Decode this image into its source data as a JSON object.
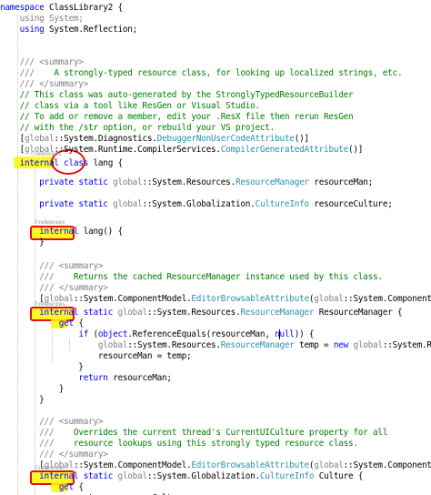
{
  "lens": {
    "ref_0": "0 references",
    "ref_1": "0 references",
    "ref_2": "0 references",
    "ref_3": "0 references"
  },
  "code": {
    "l1": [
      {
        "t": "namespace",
        "c": "k"
      },
      {
        "t": " ClassLibrary2 {",
        "c": "x"
      }
    ],
    "l2": [
      {
        "t": "    using System;",
        "c": "g"
      }
    ],
    "l3": [
      {
        "t": "    ",
        "c": "x"
      },
      {
        "t": "using",
        "c": "k"
      },
      {
        "t": " System.Reflection;",
        "c": "x"
      }
    ],
    "l4": [],
    "l5": [],
    "l6": [
      {
        "t": "    /// <summary>",
        "c": "g"
      }
    ],
    "l7": [
      {
        "t": "    ///",
        "c": "g"
      },
      {
        "t": "    A strongly-typed resource class, for looking up localized strings, etc.",
        "c": "c"
      }
    ],
    "l8": [
      {
        "t": "    /// </summary>",
        "c": "g"
      }
    ],
    "l9": [
      {
        "t": "    // This class was auto-generated by the StronglyTypedResourceBuilder",
        "c": "c"
      }
    ],
    "l10": [
      {
        "t": "    // class via a tool like ResGen or Visual Studio.",
        "c": "c"
      }
    ],
    "l11": [
      {
        "t": "    // To add or remove a member, edit your .ResX file then rerun ResGen",
        "c": "c"
      }
    ],
    "l12": [
      {
        "t": "    // with the /str option, or rebuild your VS project.",
        "c": "c"
      }
    ],
    "l13": [
      {
        "t": "    [",
        "c": "x"
      },
      {
        "t": "global",
        "c": "gl"
      },
      {
        "t": "::System.Diagnostics.",
        "c": "x"
      },
      {
        "t": "DebuggerNonUserCodeAttribute",
        "c": "t"
      },
      {
        "t": "()]",
        "c": "x"
      }
    ],
    "l14": [
      {
        "t": "    [",
        "c": "x"
      },
      {
        "t": "global",
        "c": "gl"
      },
      {
        "t": "::System.Runtime.CompilerServices.",
        "c": "x"
      },
      {
        "t": "CompilerGeneratedAttribute",
        "c": "t"
      },
      {
        "t": "()]",
        "c": "x"
      }
    ],
    "l15": [
      {
        "t": "    internal",
        "c": "k"
      },
      {
        "t": " ",
        "c": "x"
      },
      {
        "t": "class",
        "c": "k"
      },
      {
        "t": " lang {",
        "c": "x"
      }
    ],
    "l16": [],
    "l17": [
      {
        "t": "        ",
        "c": "x"
      },
      {
        "t": "private",
        "c": "k"
      },
      {
        "t": " ",
        "c": "x"
      },
      {
        "t": "static",
        "c": "k"
      },
      {
        "t": " ",
        "c": "x"
      },
      {
        "t": "global",
        "c": "gl"
      },
      {
        "t": "::System.Resources.",
        "c": "x"
      },
      {
        "t": "ResourceManager",
        "c": "t"
      },
      {
        "t": " resourceMan;",
        "c": "x"
      }
    ],
    "l18": [],
    "l19": [
      {
        "t": "        ",
        "c": "x"
      },
      {
        "t": "private",
        "c": "k"
      },
      {
        "t": " ",
        "c": "x"
      },
      {
        "t": "static",
        "c": "k"
      },
      {
        "t": " ",
        "c": "x"
      },
      {
        "t": "global",
        "c": "gl"
      },
      {
        "t": "::System.Globalization.",
        "c": "x"
      },
      {
        "t": "CultureInfo",
        "c": "t"
      },
      {
        "t": " resourceCulture;",
        "c": "x"
      }
    ],
    "l20": [],
    "l21": [
      {
        "t": "        ",
        "c": "x"
      },
      {
        "t": "internal",
        "c": "k"
      },
      {
        "t": " lang() {",
        "c": "x"
      }
    ],
    "l22": [
      {
        "t": "        }",
        "c": "x"
      }
    ],
    "l23": [],
    "l24": [
      {
        "t": "        /// <summary>",
        "c": "g"
      }
    ],
    "l25": [
      {
        "t": "        ///",
        "c": "g"
      },
      {
        "t": "    Returns the cached ResourceManager instance used by this class.",
        "c": "c"
      }
    ],
    "l26": [
      {
        "t": "        /// </summary>",
        "c": "g"
      }
    ],
    "l27": [
      {
        "t": "        [",
        "c": "x"
      },
      {
        "t": "global",
        "c": "gl"
      },
      {
        "t": "::System.ComponentModel.",
        "c": "x"
      },
      {
        "t": "EditorBrowsableAttribute",
        "c": "t"
      },
      {
        "t": "(",
        "c": "x"
      },
      {
        "t": "global",
        "c": "gl"
      },
      {
        "t": "::System.ComponentModel.",
        "c": "x"
      },
      {
        "t": "Edito",
        "c": "t"
      }
    ],
    "l28": [
      {
        "t": "        ",
        "c": "x"
      },
      {
        "t": "internal",
        "c": "k"
      },
      {
        "t": " ",
        "c": "x"
      },
      {
        "t": "static",
        "c": "k"
      },
      {
        "t": " ",
        "c": "x"
      },
      {
        "t": "global",
        "c": "gl"
      },
      {
        "t": "::System.Resources.",
        "c": "x"
      },
      {
        "t": "ResourceManager",
        "c": "t"
      },
      {
        "t": " ResourceManager {",
        "c": "x"
      }
    ],
    "l29": [
      {
        "t": "            ",
        "c": "x"
      },
      {
        "t": "get",
        "c": "k"
      },
      {
        "t": " {",
        "c": "x"
      }
    ],
    "l30": [
      {
        "t": "                ",
        "c": "x"
      },
      {
        "t": "if",
        "c": "k"
      },
      {
        "t": " (",
        "c": "x"
      },
      {
        "t": "object",
        "c": "k"
      },
      {
        "t": ".ReferenceEquals(resourceMan, ",
        "c": "x"
      },
      {
        "t": "null",
        "c": "k"
      },
      {
        "t": ")) {",
        "c": "x"
      }
    ],
    "l31": [
      {
        "t": "                    ",
        "c": "x"
      },
      {
        "t": "global",
        "c": "gl"
      },
      {
        "t": "::System.Resources.",
        "c": "x"
      },
      {
        "t": "ResourceManager",
        "c": "t"
      },
      {
        "t": " temp = ",
        "c": "x"
      },
      {
        "t": "new",
        "c": "k"
      },
      {
        "t": " ",
        "c": "x"
      },
      {
        "t": "global",
        "c": "gl"
      },
      {
        "t": "::System.Resources.",
        "c": "x"
      }
    ],
    "l32": [
      {
        "t": "                    resourceMan = temp;",
        "c": "x"
      }
    ],
    "l33": [
      {
        "t": "                }",
        "c": "x"
      }
    ],
    "l34": [
      {
        "t": "                ",
        "c": "x"
      },
      {
        "t": "return",
        "c": "k"
      },
      {
        "t": " resourceMan;",
        "c": "x"
      }
    ],
    "l35": [
      {
        "t": "            }",
        "c": "x"
      }
    ],
    "l36": [
      {
        "t": "        }",
        "c": "x"
      }
    ],
    "l37": [],
    "l38": [
      {
        "t": "        /// <summary>",
        "c": "g"
      }
    ],
    "l39": [
      {
        "t": "        ///",
        "c": "g"
      },
      {
        "t": "    Overrides the current thread's CurrentUICulture property for all",
        "c": "c"
      }
    ],
    "l40": [
      {
        "t": "        ///",
        "c": "g"
      },
      {
        "t": "    resource lookups using this strongly typed resource class.",
        "c": "c"
      }
    ],
    "l41": [
      {
        "t": "        /// </summary>",
        "c": "g"
      }
    ],
    "l42": [
      {
        "t": "        [",
        "c": "x"
      },
      {
        "t": "global",
        "c": "gl"
      },
      {
        "t": "::System.ComponentModel.",
        "c": "x"
      },
      {
        "t": "EditorBrowsableAttribute",
        "c": "t"
      },
      {
        "t": "(",
        "c": "x"
      },
      {
        "t": "global",
        "c": "gl"
      },
      {
        "t": "::System.ComponentModel.",
        "c": "x"
      },
      {
        "t": "Edito",
        "c": "t"
      }
    ],
    "l43": [
      {
        "t": "        ",
        "c": "x"
      },
      {
        "t": "internal",
        "c": "k"
      },
      {
        "t": " ",
        "c": "x"
      },
      {
        "t": "static",
        "c": "k"
      },
      {
        "t": " ",
        "c": "x"
      },
      {
        "t": "global",
        "c": "gl"
      },
      {
        "t": "::System.Globalization.",
        "c": "x"
      },
      {
        "t": "CultureInfo",
        "c": "t"
      },
      {
        "t": " Culture {",
        "c": "x"
      }
    ],
    "l44": [
      {
        "t": "            ",
        "c": "x"
      },
      {
        "t": "get",
        "c": "k"
      },
      {
        "t": " {",
        "c": "x"
      }
    ],
    "l45": [
      {
        "t": "                return resourceCulture;",
        "c": "x"
      }
    ]
  }
}
